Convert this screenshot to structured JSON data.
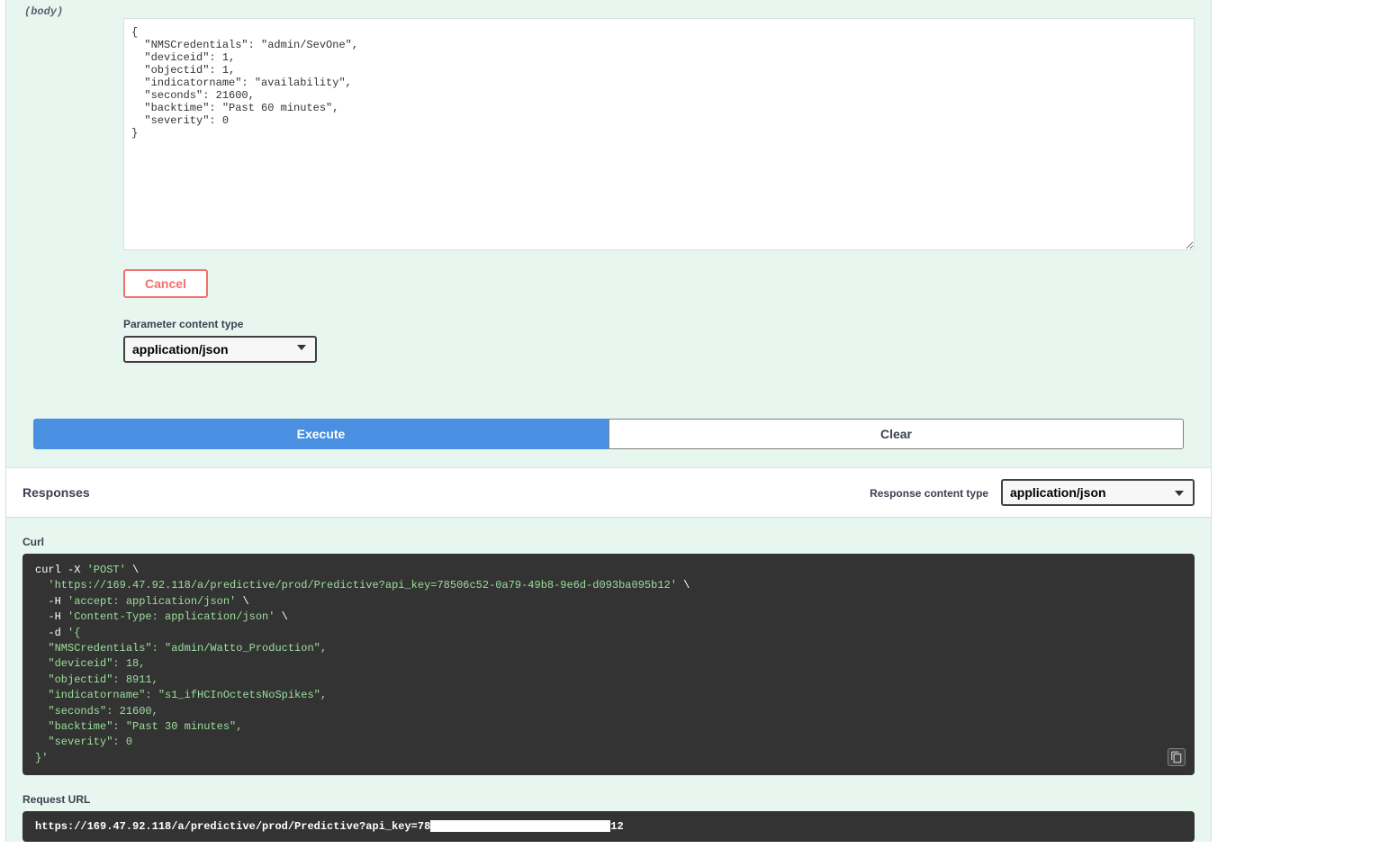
{
  "body_label": "(body)",
  "body_textarea_value": "{\n  \"NMSCredentials\": \"admin/SevOne\",\n  \"deviceid\": 1,\n  \"objectid\": 1,\n  \"indicatorname\": \"availability\",\n  \"seconds\": 21600,\n  \"backtime\": \"Past 60 minutes\",\n  \"severity\": 0\n}",
  "cancel_label": "Cancel",
  "param_content_type_label": "Parameter content type",
  "param_content_type_value": "application/json",
  "execute_label": "Execute",
  "clear_label": "Clear",
  "responses_title": "Responses",
  "response_content_type_label": "Response content type",
  "response_content_type_value": "application/json",
  "curl_label": "Curl",
  "curl_parts": {
    "l1a": "curl -X ",
    "l1b": "'POST'",
    "l1c": " \\",
    "l2a": "  ",
    "l2b": "'https://169.47.92.118/a/predictive/prod/Predictive?api_key=78506c52-0a79-49b8-9e6d-d093ba095b12'",
    "l2c": " \\",
    "l3a": "  -H ",
    "l3b": "'accept: application/json'",
    "l3c": " \\",
    "l4a": "  -H ",
    "l4b": "'Content-Type: application/json'",
    "l4c": " \\",
    "l5a": "  -d ",
    "l5b": "'{",
    "l6": "  \"NMSCredentials\": \"admin/Watto_Production\",",
    "l7": "  \"deviceid\": 18,",
    "l8": "  \"objectid\": 8911,",
    "l9": "  \"indicatorname\": \"s1_ifHCInOctetsNoSpikes\",",
    "l10": "  \"seconds\": 21600,",
    "l11": "  \"backtime\": \"Past 30 minutes\",",
    "l12": "  \"severity\": 0",
    "l13": "}'"
  },
  "request_url_label": "Request URL",
  "request_url_prefix": "https://169.47.92.118/a/predictive/prod/Predictive?api_key=78",
  "request_url_suffix": "12"
}
